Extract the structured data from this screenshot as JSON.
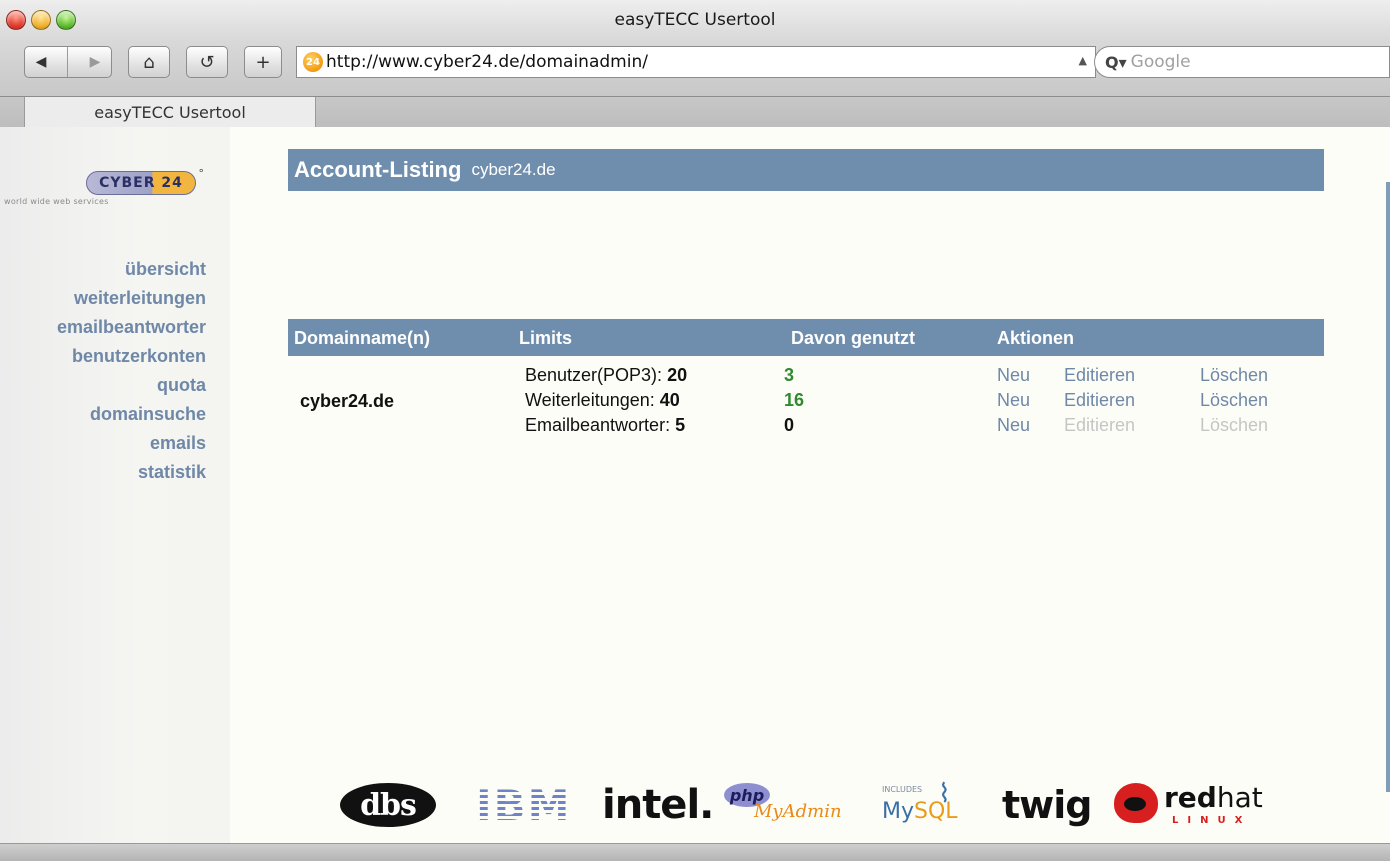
{
  "window": {
    "title": "easyTECC Usertool"
  },
  "toolbar": {
    "back_glyph": "◀",
    "forward_glyph": "▶",
    "home_glyph": "⌂",
    "reload_glyph": "↺",
    "add_glyph": "+",
    "url": "http://www.cyber24.de/domainadmin/",
    "favicon_text": "24",
    "search_placeholder": "Google"
  },
  "tabs": [
    {
      "label": "easyTECC Usertool"
    }
  ],
  "sidebar": {
    "logo_text": "CYBER 24",
    "logo_deg": "°",
    "tagline": "world wide web services",
    "nav": [
      {
        "label": "übersicht"
      },
      {
        "label": "weiterleitungen"
      },
      {
        "label": "emailbeantworter"
      },
      {
        "label": "benutzerkonten"
      },
      {
        "label": "quota"
      },
      {
        "label": "domainsuche"
      },
      {
        "label": "emails"
      },
      {
        "label": "statistik"
      }
    ]
  },
  "page": {
    "title": "Account-Listing",
    "subtitle": "cyber24.de"
  },
  "table": {
    "headers": [
      "Domainname(n)",
      "Limits",
      "Davon genutzt",
      "Aktionen"
    ],
    "rows": [
      {
        "domain": "cyber24.de",
        "limits": [
          {
            "label": "Benutzer(POP3):",
            "value": "20"
          },
          {
            "label": "Weiterleitungen:",
            "value": "40"
          },
          {
            "label": "Emailbeantworter:",
            "value": "5"
          }
        ],
        "used": [
          "3",
          "16",
          "0"
        ],
        "actions": [
          {
            "neu": "Neu",
            "edit": "Editieren",
            "del": "Löschen",
            "enabled": true
          },
          {
            "neu": "Neu",
            "edit": "Editieren",
            "del": "Löschen",
            "enabled": true
          },
          {
            "neu": "Neu",
            "edit": "Editieren",
            "del": "Löschen",
            "enabled": false
          }
        ]
      }
    ]
  },
  "footer_logos": {
    "dbs": "dbs",
    "ibm": "IBM",
    "intel": "intel.",
    "php": "php",
    "myadmin": "MyAdmin",
    "mysql_small": "INCLUDES",
    "mysql_my": "My",
    "mysql_sql": "SQL",
    "twig": "twig",
    "redhat_red": "red",
    "redhat_hat": "hat",
    "redhat_linux": "LINUX"
  },
  "colors": {
    "accent": "#6f8eae",
    "nav_link": "#6f88a8",
    "used_green": "#2f8a2f",
    "disabled": "#c5c5c5"
  }
}
